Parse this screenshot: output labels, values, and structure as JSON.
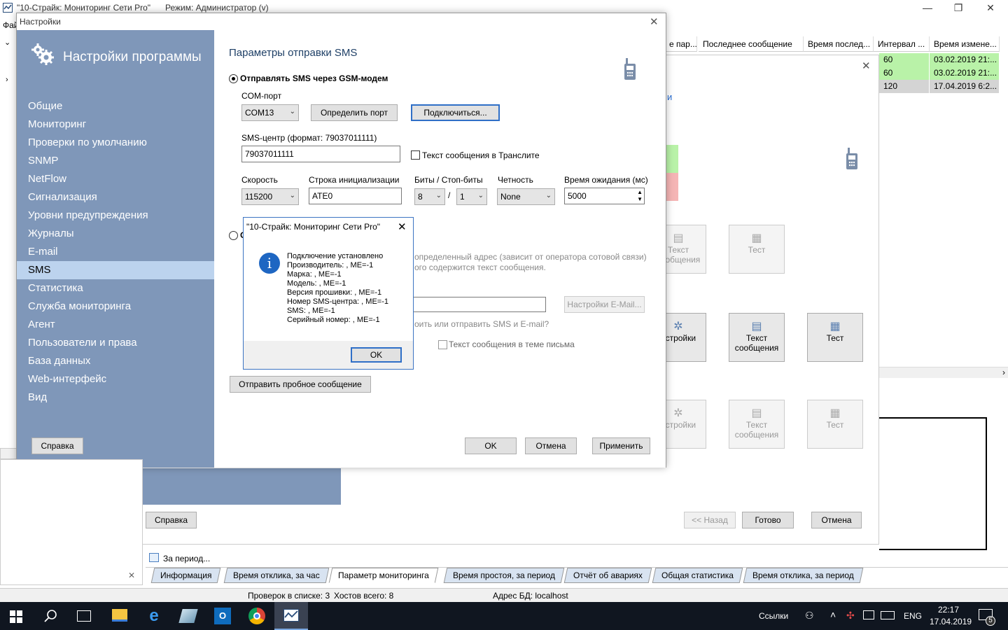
{
  "app": {
    "title": "\"10-Страйк: Мониторинг Сети Pro\"",
    "mode": "Режим: Администратор (v)",
    "menu_file": "Фай"
  },
  "grid": {
    "headers": [
      "е пар...",
      "Последнее сообщение",
      "Время послед...",
      "Интервал ...",
      "Время измене..."
    ],
    "rows": [
      {
        "interval": "60",
        "changed": "03.02.2019 21:...",
        "color": "#b9f2a8"
      },
      {
        "interval": "60",
        "changed": "03.02.2019 21:...",
        "color": "#b9f2a8"
      },
      {
        "interval": "120",
        "changed": "17.04.2019 6:2...",
        "color": "#d4d4d4"
      }
    ]
  },
  "wizard": {
    "partial_text": "и",
    "tiles": {
      "row1": [
        "Текст сообщения",
        "Тест"
      ],
      "row2": [
        "астройки",
        "Текст сообщения",
        "Тест"
      ],
      "row3": [
        "астройки",
        "Текст сообщения",
        "Тест"
      ]
    },
    "help_button": "Справка",
    "back_button": "<< Назад",
    "done_button": "Готово",
    "cancel_button": "Отмена"
  },
  "settings": {
    "window_title": "Настройки",
    "header": "Настройки программы",
    "nav": [
      "Общие",
      "Мониторинг",
      "Проверки по умолчанию",
      "SNMP",
      "NetFlow",
      "Сигнализация",
      "Уровни предупреждения",
      "Журналы",
      "E-mail",
      "SMS",
      "Статистика",
      "Служба мониторинга",
      "Агент",
      "Пользователи и права",
      "База данных",
      "Web-интерфейс",
      "Вид"
    ],
    "selected_nav": "SMS",
    "help_button": "Справка",
    "section_title": "Параметры отправки SMS",
    "radio_gsm": "Отправлять SMS через GSM-модем",
    "com_port_label": "COM-порт",
    "com_port_value": "COM13",
    "detect_port_button": "Определить порт",
    "connect_button": "Подключиться...",
    "sms_center_label": "SMS-центр (формат: 79037011111)",
    "sms_center_value": "79037011111",
    "translit_label": "Текст сообщения в Транслите",
    "speed_label": "Скорость",
    "speed_value": "115200",
    "init_label": "Строка инициализации",
    "init_value": "ATE0",
    "bits_label": "Биты / Стоп-биты",
    "bits_value": "8",
    "bits_sep": "/",
    "stop_bits_value": "1",
    "parity_label": "Четность",
    "parity_value": "None",
    "timeout_label": "Время ожидания (мс)",
    "timeout_value": "5000",
    "radio_email_partial": "С",
    "email_desc_1": "определенный адрес (зависит от оператора сотовой связи)",
    "email_desc_2": "ого содержится текст сообщения.",
    "email_settings_button": "Настройки E-Mail...",
    "test_question": "оить или отправить SMS и E-mail?",
    "subject_checkbox": "Текст сообщения в теме письма",
    "send_test_button": "Отправить пробное сообщение",
    "ok_button": "OK",
    "cancel_button": "Отмена",
    "apply_button": "Применить"
  },
  "msgbox": {
    "title": "\"10-Страйк: Мониторинг Сети Pro\"",
    "lines": [
      "Подключение установлено",
      "Производитель: , ME=-1",
      "Марка: , ME=-1",
      "Модель: , ME=-1",
      "Версия прошивки: , ME=-1",
      "Номер SMS-центра: , ME=-1",
      "SMS: , ME=-1",
      "Серийный номер: , ME=-1"
    ],
    "ok_button": "OK"
  },
  "bottom": {
    "period_label": "За период...",
    "tabs": [
      "Информация",
      "Время отклика, за час",
      "Параметр мониторинга",
      "Время простоя, за период",
      "Отчёт об авариях",
      "Общая статистика",
      "Время отклика, за период"
    ],
    "active_tab": "Параметр мониторинга"
  },
  "statusbar": {
    "checks": "Проверок в списке: 3",
    "hosts": "Хостов всего: 8",
    "db": "Адрес БД: localhost"
  },
  "taskbar": {
    "links": "Ссылки",
    "lang": "ENG",
    "time": "22:17",
    "date": "17.04.2019",
    "notifications": "5"
  }
}
